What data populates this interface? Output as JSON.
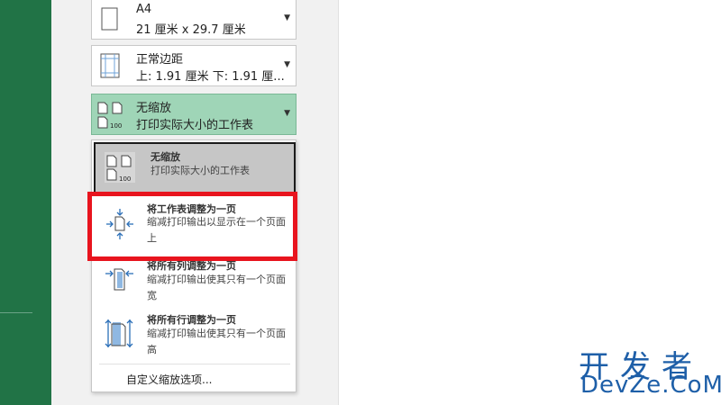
{
  "paper": {
    "title": "A4",
    "size": "21 厘米 x 29.7 厘米"
  },
  "margins": {
    "title": "正常边距",
    "detail": "上: 1.91 厘米 下: 1.91 厘..."
  },
  "scaling": {
    "title": "无缩放",
    "detail": "打印实际大小的工作表"
  },
  "scaling_menu": {
    "items": [
      {
        "title": "无缩放",
        "desc": "打印实际大小的工作表",
        "icon": "no-scaling-icon",
        "selected": true
      },
      {
        "title": "将工作表调整为一页",
        "desc": "缩减打印输出以显示在一个页面上",
        "icon": "fit-sheet-one-page-icon"
      },
      {
        "title": "将所有列调整为一页",
        "desc": "缩减打印输出使其只有一个页面宽",
        "icon": "fit-columns-one-page-icon"
      },
      {
        "title": "将所有行调整为一页",
        "desc": "缩减打印输出使其只有一个页面高",
        "icon": "fit-rows-one-page-icon"
      }
    ],
    "custom_label": "自定义缩放选项..."
  },
  "icon_labels": {
    "hundred": "100"
  },
  "watermark": {
    "line1": "开发者",
    "line2": "DevZe.CoM"
  },
  "colors": {
    "excel_green": "#217346",
    "highlight_red": "#e8141e",
    "watermark_blue": "#1e5fa8",
    "selected_green": "#9fd5b7"
  }
}
